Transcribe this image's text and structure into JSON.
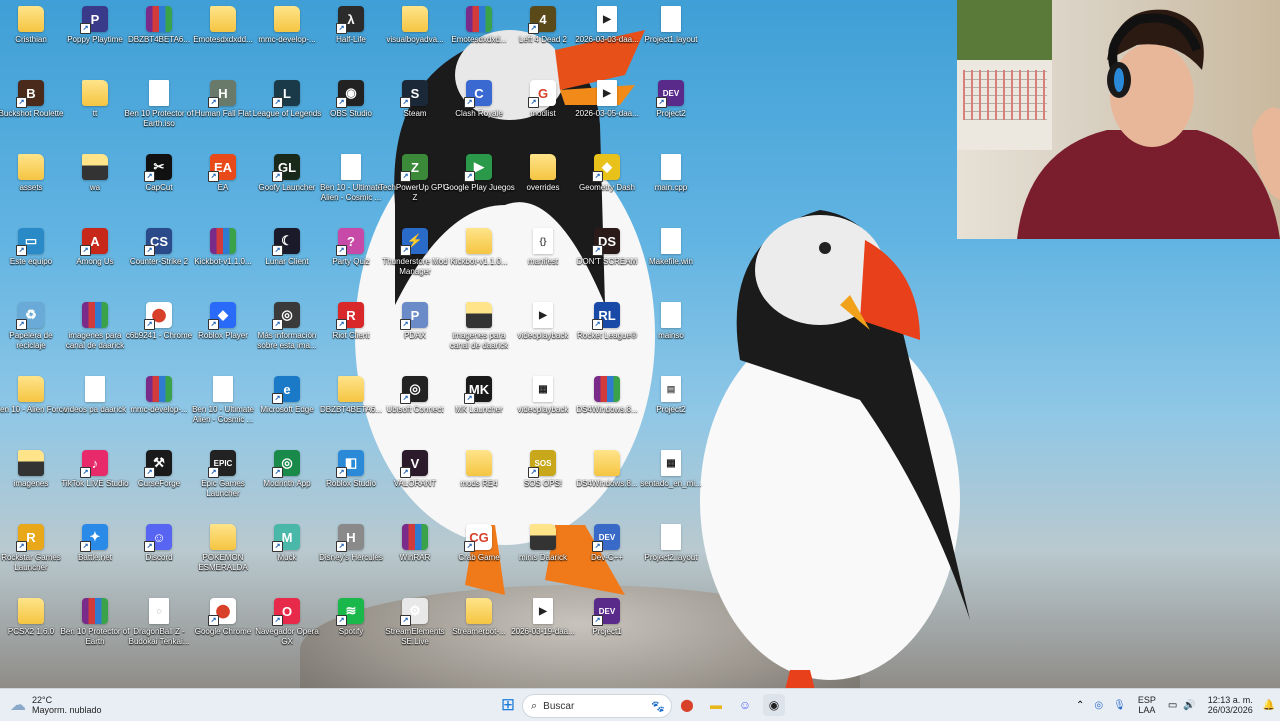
{
  "desktop": {
    "icons": [
      {
        "label": "Cristhian",
        "type": "folder",
        "color": "#f5c542",
        "glyph": ""
      },
      {
        "label": "Poppy Playtime",
        "type": "app",
        "color": "#3a3a8a",
        "glyph": "P"
      },
      {
        "label": "DBZBT4BETA6...",
        "type": "rar",
        "color": "#7a2b8a",
        "glyph": ""
      },
      {
        "label": "Emotesdxdxdd...",
        "type": "folder",
        "color": "#f5c542",
        "glyph": ""
      },
      {
        "label": "mmc-develop-...",
        "type": "folder",
        "color": "#f5c542",
        "glyph": ""
      },
      {
        "label": "Half-Life",
        "type": "app",
        "color": "#2b2b2b",
        "glyph": "λ"
      },
      {
        "label": "visualboyadva...",
        "type": "folder",
        "color": "#f5c542",
        "glyph": ""
      },
      {
        "label": "Emotesdxdxd...",
        "type": "rar",
        "color": "#7a2b8a",
        "glyph": ""
      },
      {
        "label": "Left 4 Dead 2",
        "type": "app",
        "color": "#5a4a1a",
        "glyph": "4"
      },
      {
        "label": "2026-03-03-daa...",
        "type": "video",
        "color": "#ffffff",
        "glyph": "▶"
      },
      {
        "label": "Project1.layout",
        "type": "file",
        "color": "#ffffff",
        "glyph": ""
      },
      {
        "label": "Buckshot Roulette",
        "type": "app",
        "color": "#4a2a1a",
        "glyph": "B"
      },
      {
        "label": "tt",
        "type": "folder",
        "color": "#f5c542",
        "glyph": ""
      },
      {
        "label": "Ben 10 Protector of Earth.iso",
        "type": "file",
        "color": "#ffffff",
        "glyph": ""
      },
      {
        "label": "Human Fall Flat",
        "type": "app",
        "color": "#6a7a6a",
        "glyph": "H"
      },
      {
        "label": "League of Legends",
        "type": "app",
        "color": "#1a3a4a",
        "glyph": "L"
      },
      {
        "label": "OBS Studio",
        "type": "app",
        "color": "#222222",
        "glyph": "◉"
      },
      {
        "label": "Steam",
        "type": "app",
        "color": "#1b2838",
        "glyph": "S"
      },
      {
        "label": "Clash Royale",
        "type": "app",
        "color": "#3a6ad1",
        "glyph": "C"
      },
      {
        "label": "modlist",
        "type": "app",
        "color": "#ffffff",
        "glyph": "G"
      },
      {
        "label": "2026-03-05-daa...",
        "type": "video",
        "color": "#ffffff",
        "glyph": "▶"
      },
      {
        "label": "Project2",
        "type": "app",
        "color": "#5a2a8a",
        "glyph": "DEV"
      },
      {
        "label": "assets",
        "type": "folder",
        "color": "#f5c542",
        "glyph": ""
      },
      {
        "label": "wa",
        "type": "folder",
        "color": "#333333",
        "glyph": ""
      },
      {
        "label": "CapCut",
        "type": "app",
        "color": "#111111",
        "glyph": "✂"
      },
      {
        "label": "EA",
        "type": "app",
        "color": "#e84a1a",
        "glyph": "EA"
      },
      {
        "label": "Goofy Launcher",
        "type": "app",
        "color": "#1a2a1a",
        "glyph": "GL"
      },
      {
        "label": "Ben 10 - Ultimate Alien - Cosmic ...",
        "type": "file",
        "color": "#ffffff",
        "glyph": ""
      },
      {
        "label": "TechPowerUp GPU-Z",
        "type": "app",
        "color": "#3a8a3a",
        "glyph": "Z"
      },
      {
        "label": "Google Play Juegos",
        "type": "app",
        "color": "#2a9a4a",
        "glyph": "▶"
      },
      {
        "label": "overrides",
        "type": "folder",
        "color": "#f5c542",
        "glyph": ""
      },
      {
        "label": "Geometry Dash",
        "type": "app",
        "color": "#e8c21a",
        "glyph": "◆"
      },
      {
        "label": "main.cpp",
        "type": "file",
        "color": "#ffffff",
        "glyph": ""
      },
      {
        "label": "Este equipo",
        "type": "app",
        "color": "#2a8ac8",
        "glyph": "▭"
      },
      {
        "label": "Among Us",
        "type": "app",
        "color": "#c8281a",
        "glyph": "A"
      },
      {
        "label": "Counter-Strike 2",
        "type": "app",
        "color": "#2a4a8a",
        "glyph": "CS"
      },
      {
        "label": "Kickbot-v1.1.0...",
        "type": "rar",
        "color": "#7a2b8a",
        "glyph": ""
      },
      {
        "label": "Lunar Client",
        "type": "app",
        "color": "#1a1a2a",
        "glyph": "☾"
      },
      {
        "label": "Party Quiz",
        "type": "app",
        "color": "#c84aa8",
        "glyph": "?"
      },
      {
        "label": "Thunderstore Mod Manager",
        "type": "app",
        "color": "#2a6ac8",
        "glyph": "⚡"
      },
      {
        "label": "Kickbot-v1.1.0...",
        "type": "folder",
        "color": "#f5c542",
        "glyph": ""
      },
      {
        "label": "manifest",
        "type": "file",
        "color": "#ffffff",
        "glyph": "{}"
      },
      {
        "label": "DON'T SCREAM",
        "type": "app",
        "color": "#2a1a1a",
        "glyph": "DS"
      },
      {
        "label": "Makefile.win",
        "type": "file",
        "color": "#ffffff",
        "glyph": ""
      },
      {
        "label": "Papelera de reciclaje",
        "type": "app",
        "color": "#6aaad8",
        "glyph": "♻"
      },
      {
        "label": "imagenes para canal de daarick",
        "type": "rar",
        "color": "#7a2b8a",
        "glyph": ""
      },
      {
        "label": "c6b9241 - Chrome",
        "type": "app",
        "color": "#ffffff",
        "glyph": "⬤"
      },
      {
        "label": "Roblox Player",
        "type": "app",
        "color": "#2a6af8",
        "glyph": "◆"
      },
      {
        "label": "Más información sobre esta ima...",
        "type": "app",
        "color": "#3a3a3a",
        "glyph": "◎"
      },
      {
        "label": "Riot Client",
        "type": "app",
        "color": "#d8282a",
        "glyph": "R"
      },
      {
        "label": "PDAX",
        "type": "app",
        "color": "#6a8ac8",
        "glyph": "P"
      },
      {
        "label": "imagenes para canal de daarick",
        "type": "folder",
        "color": "#333333",
        "glyph": ""
      },
      {
        "label": "videoplayback",
        "type": "video",
        "color": "#ffffff",
        "glyph": "▶"
      },
      {
        "label": "Rocket League®",
        "type": "app",
        "color": "#1a4aa8",
        "glyph": "RL"
      },
      {
        "label": "mainso",
        "type": "file",
        "color": "#ffffff",
        "glyph": ""
      },
      {
        "label": "Ben 10 - Alien Force",
        "type": "folder",
        "color": "#f5c542",
        "glyph": ""
      },
      {
        "label": "videos pa daarick",
        "type": "file",
        "color": "#ffffff",
        "glyph": ""
      },
      {
        "label": "mmc-develop-...",
        "type": "rar",
        "color": "#7a2b8a",
        "glyph": ""
      },
      {
        "label": "Ben 10 - Ultimate Alien - Cosmic ...",
        "type": "file",
        "color": "#ffffff",
        "glyph": ""
      },
      {
        "label": "Microsoft Edge",
        "type": "app",
        "color": "#1a7ac8",
        "glyph": "e"
      },
      {
        "label": "DBZBT4BETA6...",
        "type": "folder",
        "color": "#f5c542",
        "glyph": ""
      },
      {
        "label": "Ubisoft Connect",
        "type": "app",
        "color": "#222222",
        "glyph": "◎"
      },
      {
        "label": "MK Launcher",
        "type": "app",
        "color": "#1a1a1a",
        "glyph": "MK"
      },
      {
        "label": "videoplayback",
        "type": "video",
        "color": "#4a4a4a",
        "glyph": "▦"
      },
      {
        "label": "DS4Windows.8...",
        "type": "rar",
        "color": "#7a2b8a",
        "glyph": ""
      },
      {
        "label": "Project2",
        "type": "file",
        "color": "#ffffff",
        "glyph": "▤"
      },
      {
        "label": "imagenes",
        "type": "folder",
        "color": "#333333",
        "glyph": ""
      },
      {
        "label": "TikTok LIVE Studio",
        "type": "app",
        "color": "#e82a6a",
        "glyph": "♪"
      },
      {
        "label": "CurseForge",
        "type": "app",
        "color": "#1a1a1a",
        "glyph": "⚒"
      },
      {
        "label": "Epic Games Launcher",
        "type": "app",
        "color": "#222222",
        "glyph": "EPIC"
      },
      {
        "label": "Modrinth App",
        "type": "app",
        "color": "#1a8a4a",
        "glyph": "◎"
      },
      {
        "label": "Roblox Studio",
        "type": "app",
        "color": "#2a8ad8",
        "glyph": "◧"
      },
      {
        "label": "VALORANT",
        "type": "app",
        "color": "#2a1a2a",
        "glyph": "V"
      },
      {
        "label": "mods RE4",
        "type": "folder",
        "color": "#f5c542",
        "glyph": ""
      },
      {
        "label": "SOS OPS!",
        "type": "app",
        "color": "#c8a81a",
        "glyph": "SOS"
      },
      {
        "label": "DS4Windows.8...",
        "type": "folder",
        "color": "#f5c542",
        "glyph": ""
      },
      {
        "label": "sentado_en_mi...",
        "type": "video",
        "color": "#4a4a4a",
        "glyph": "▦"
      },
      {
        "label": "Rockstar Games Launcher",
        "type": "app",
        "color": "#e8a81a",
        "glyph": "R"
      },
      {
        "label": "Battle.net",
        "type": "app",
        "color": "#2a8ae8",
        "glyph": "✦"
      },
      {
        "label": "Discord",
        "type": "app",
        "color": "#5865f2",
        "glyph": "☺"
      },
      {
        "label": "POKEMON ESMERALDA",
        "type": "folder",
        "color": "#f5c542",
        "glyph": ""
      },
      {
        "label": "Muck",
        "type": "app",
        "color": "#4ab8a8",
        "glyph": "M"
      },
      {
        "label": "Disney's Hercules",
        "type": "app",
        "color": "#8a8a8a",
        "glyph": "H"
      },
      {
        "label": "WinRAR",
        "type": "rar",
        "color": "#7a2b8a",
        "glyph": ""
      },
      {
        "label": "Crab Game",
        "type": "app",
        "color": "#ffffff",
        "glyph": "CG"
      },
      {
        "label": "minis Daarick",
        "type": "folder",
        "color": "#333333",
        "glyph": ""
      },
      {
        "label": "Dev-C++",
        "type": "app",
        "color": "#3a6ac8",
        "glyph": "DEV"
      },
      {
        "label": "Project2.layout",
        "type": "file",
        "color": "#ffffff",
        "glyph": ""
      },
      {
        "label": "PCSX2 1.6.0",
        "type": "folder",
        "color": "#f5c542",
        "glyph": ""
      },
      {
        "label": "Ben 10 Protector of Earth",
        "type": "rar",
        "color": "#7a2b8a",
        "glyph": ""
      },
      {
        "label": "DragonBall Z - Budokai Tenkai...",
        "type": "file",
        "color": "#ffffff",
        "glyph": "◌"
      },
      {
        "label": "Google Chrome",
        "type": "app",
        "color": "#ffffff",
        "glyph": "⬤"
      },
      {
        "label": "Navegador Opera GX",
        "type": "app",
        "color": "#e82a4a",
        "glyph": "O"
      },
      {
        "label": "Spotify",
        "type": "app",
        "color": "#1ab84a",
        "glyph": "≋"
      },
      {
        "label": "StreamElements SE.Live",
        "type": "app",
        "color": "#e8e8e8",
        "glyph": "⚙"
      },
      {
        "label": "Streamerbot-...",
        "type": "folder",
        "color": "#f5c542",
        "glyph": ""
      },
      {
        "label": "2026-03-19-daa...",
        "type": "video",
        "color": "#ffffff",
        "glyph": "▶"
      },
      {
        "label": "Project1",
        "type": "app",
        "color": "#5a2a8a",
        "glyph": "DEV"
      }
    ]
  },
  "taskbar": {
    "weather": {
      "temp": "22°C",
      "desc": "Mayorm. nublado"
    },
    "search_label": "Buscar",
    "pinned": [
      {
        "name": "start-button",
        "glyph": "⊞",
        "color": "#1a7ad8"
      },
      {
        "name": "chrome-taskbar",
        "glyph": "⬤",
        "color": "#d8402a"
      },
      {
        "name": "file-explorer-taskbar",
        "glyph": "▬",
        "color": "#e8b81a"
      },
      {
        "name": "discord-taskbar",
        "glyph": "☺",
        "color": "#5865f2"
      },
      {
        "name": "obs-taskbar",
        "glyph": "◉",
        "color": "#222222"
      }
    ],
    "lang_top": "ESP",
    "lang_bottom": "LAA",
    "time": "12:13 a. m.",
    "date": "26/03/2026"
  }
}
